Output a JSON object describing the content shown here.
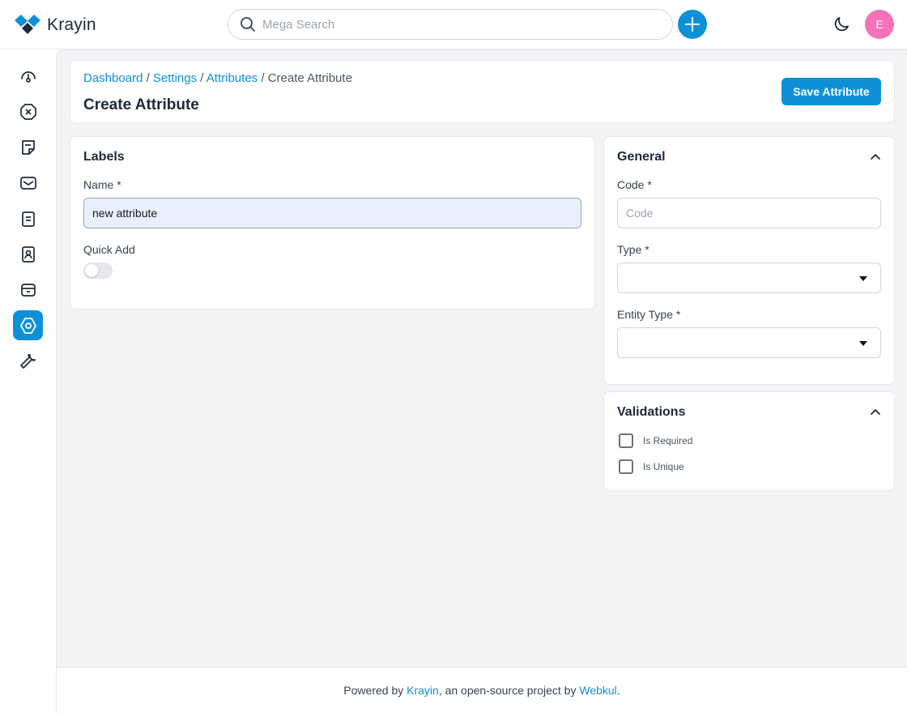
{
  "app": {
    "name": "Krayin",
    "logo_icon": "krayin-logo-icon"
  },
  "header": {
    "search_placeholder": "Mega Search",
    "avatar_initial": "E"
  },
  "sidebar": {
    "items": [
      {
        "icon": "dashboard-icon"
      },
      {
        "icon": "leads-icon"
      },
      {
        "icon": "quotes-icon"
      },
      {
        "icon": "mail-icon"
      },
      {
        "icon": "activities-icon"
      },
      {
        "icon": "contacts-icon"
      },
      {
        "icon": "products-icon"
      },
      {
        "icon": "settings-icon",
        "active": true
      },
      {
        "icon": "configuration-icon"
      }
    ]
  },
  "breadcrumb": {
    "items": [
      "Dashboard",
      "Settings",
      "Attributes"
    ],
    "separator": "/",
    "current": "Create Attribute"
  },
  "page": {
    "title": "Create Attribute",
    "save_label": "Save Attribute"
  },
  "labels": {
    "title": "Labels",
    "name_label": "Name *",
    "name_value": "new attribute",
    "quick_add_label": "Quick Add"
  },
  "general": {
    "title": "General",
    "code_label": "Code *",
    "code_placeholder": "Code",
    "type_label": "Type *",
    "entity_type_label": "Entity Type *"
  },
  "validations": {
    "title": "Validations",
    "is_required": "Is Required",
    "is_unique": "Is Unique"
  },
  "footer": {
    "prefix": "Powered by",
    "krayin_link": "Krayin",
    "middle": ", an open-source project by",
    "webkul_link": "Webkul",
    "suffix": "."
  },
  "colors": {
    "accent": "#0e90d9",
    "avatar": "#f472b6",
    "background": "#f3f4f6"
  }
}
